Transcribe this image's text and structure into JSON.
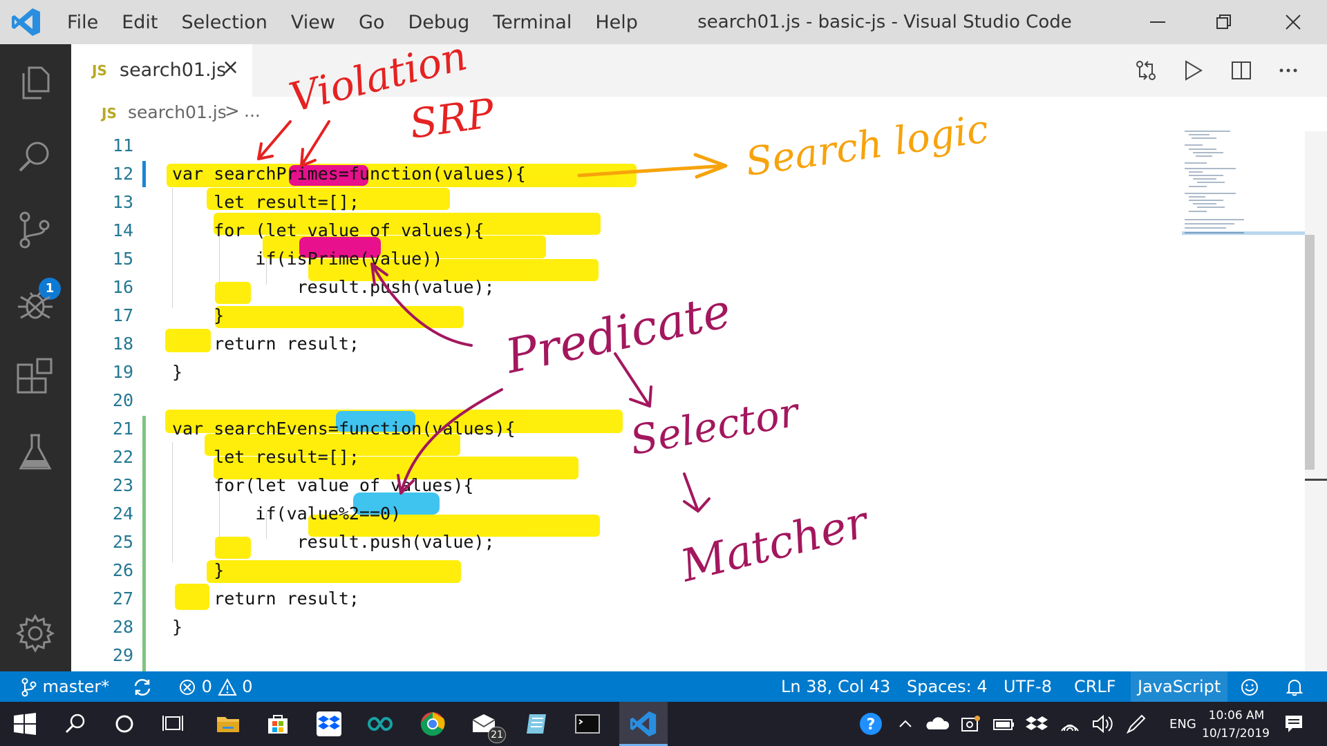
{
  "window": {
    "title": "search01.js - basic-js - Visual Studio Code",
    "menu": [
      "File",
      "Edit",
      "Selection",
      "View",
      "Go",
      "Debug",
      "Terminal",
      "Help"
    ]
  },
  "activity_bar": {
    "items": [
      "explorer-icon",
      "search-icon",
      "source-control-icon",
      "debug-icon",
      "extensions-icon",
      "test-icon"
    ],
    "scm_badge": "1",
    "bottom_item": "gear-icon"
  },
  "tab": {
    "icon_text": "JS",
    "label": "search01.js",
    "close": "×"
  },
  "breadcrumb": {
    "icon_text": "JS",
    "file": "search01.js",
    "separator": ">",
    "more": "..."
  },
  "code": {
    "lines": [
      {
        "n": "11",
        "text": ""
      },
      {
        "n": "12",
        "text": "var searchPrimes=function(values){"
      },
      {
        "n": "13",
        "text": "    let result=[];"
      },
      {
        "n": "14",
        "text": "    for (let value of values){"
      },
      {
        "n": "15",
        "text": "        if(isPrime(value))"
      },
      {
        "n": "16",
        "text": "            result.push(value);"
      },
      {
        "n": "17",
        "text": "    }"
      },
      {
        "n": "18",
        "text": "    return result;"
      },
      {
        "n": "19",
        "text": "}"
      },
      {
        "n": "20",
        "text": ""
      },
      {
        "n": "21",
        "text": "var searchEvens=function(values){"
      },
      {
        "n": "22",
        "text": "    let result=[];"
      },
      {
        "n": "23",
        "text": "    for(let value of values){"
      },
      {
        "n": "24",
        "text": "        if(value%2==0)"
      },
      {
        "n": "25",
        "text": "            result.push(value);"
      },
      {
        "n": "26",
        "text": "    }"
      },
      {
        "n": "27",
        "text": "    return result;"
      },
      {
        "n": "28",
        "text": "}"
      },
      {
        "n": "29",
        "text": ""
      }
    ]
  },
  "annotations": {
    "violation": "Violation",
    "srp": "SRP",
    "search_logic": "Search logic",
    "predicate": "Predicate",
    "selector": "Selector",
    "matcher": "Matcher"
  },
  "status_bar": {
    "branch": "master*",
    "errors": "0",
    "warnings": "0",
    "position": "Ln 38, Col 43",
    "spaces": "Spaces: 4",
    "encoding": "UTF-8",
    "eol": "CRLF",
    "language": "JavaScript"
  },
  "taskbar": {
    "mail_badge": "21",
    "language": "ENG",
    "time": "10:06 AM",
    "date": "10/17/2019"
  },
  "colors": {
    "status_bar": "#007acc",
    "activity_bar": "#2c2c2c",
    "highlight_yellow": "#ffee00",
    "highlight_magenta": "#e8108c",
    "highlight_cyan": "#3fc3ef",
    "ink_red": "#e52222",
    "ink_orange": "#f6a30c",
    "ink_purple": "#a3175e"
  }
}
